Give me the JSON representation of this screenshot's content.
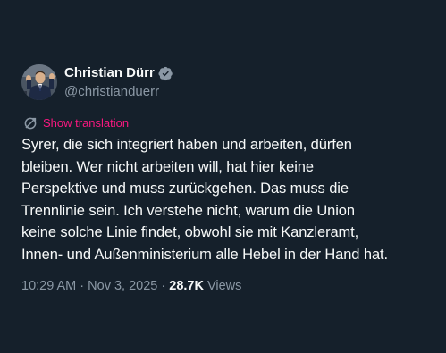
{
  "author": {
    "display_name": "Christian Dürr",
    "handle": "@christianduerr",
    "verified": true,
    "verified_color": "#8b98a5"
  },
  "translation": {
    "label": "Show translation",
    "color": "#f91880",
    "icon": "translate-icon"
  },
  "tweet": {
    "lines": [
      "Syrer, die sich integriert haben und arbeiten, dürfen",
      "bleiben. Wer nicht arbeiten will, hat hier keine",
      "Perspektive und muss zurückgehen. Das muss die",
      "Trennlinie sein. Ich verstehe nicht, warum die Union",
      "keine solche Linie findet, obwohl sie mit Kanzleramt,",
      "Innen- und Außenministerium alle Hebel in der Hand hat."
    ]
  },
  "meta": {
    "time": "10:29 AM",
    "date": "Nov 3, 2025",
    "separator": " · ",
    "views_count": "28.7K",
    "views_label": "Views"
  },
  "colors": {
    "background": "#15202b",
    "primary_text": "#f7f9f9",
    "secondary_text": "#8b98a5"
  }
}
